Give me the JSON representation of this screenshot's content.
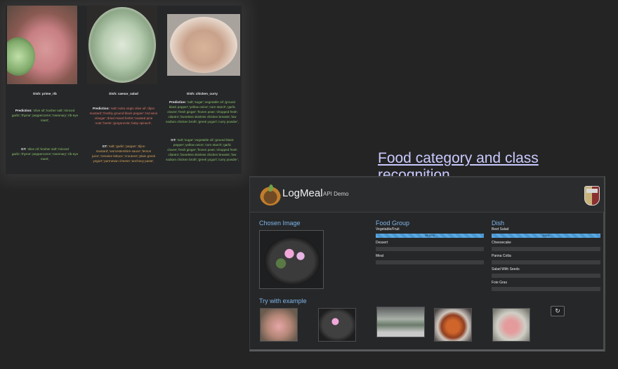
{
  "recipe_panel": {
    "columns": [
      {
        "dish": "Dish: prime_rib",
        "pred_label": "Prediction:",
        "pred_items": [
          {
            "t": "'olive oil','kosher salt','minced garlic','thyme','peppercorns','rosemary','rib-eye roast',",
            "s": "ok"
          }
        ],
        "gt_label": "GT:",
        "gt_items": [
          {
            "t": "'olive oil','kosher salt','minced garlic','thyme','peppercorns','rosemary','rib-eye roast',",
            "s": "ok"
          }
        ]
      },
      {
        "dish": "Dish: caesar_salad",
        "pred_label": "Prediction:",
        "pred_items": [
          {
            "t": "'salt','extra virgin olive oil','dijon mustard','freshly ground black pepper','red wine vinegar','dried mixed herbs','toasted pine nuts','beets','gorgonzola','baby spinach',",
            "s": "bad"
          }
        ],
        "gt_label": "GT:",
        "gt_items": [
          {
            "t": "'salt','garlic','pepper','dijon mustard','worcestershire sauce','lemon juice','romaine lettuce','croutons','plain greek yogurt','parmesan cheese','anchovy paste',",
            "s": "warn"
          }
        ]
      },
      {
        "dish": "Dish: chicken_curry",
        "pred_label": "Prediction:",
        "pred_items": [
          {
            "t": "'salt','sugar','vegetable oil','ground black pepper','yellow onion','corn starch','garlic cloves','fresh ginger','frozen peas','chopped fresh cilantro','boneless skinless chicken breasts','low sodium chicken broth','greek yogurt','curry powder',",
            "s": "ok"
          }
        ],
        "gt_label": "GT:",
        "gt_items": [
          {
            "t": "'salt','sugar','vegetable oil','ground black pepper','yellow onion','corn starch','garlic cloves','fresh ginger','frozen peas','chopped fresh cilantro','boneless skinless chicken breasts','low sodium chicken broth','greek yogurt','curry powder',",
            "s": "ok"
          }
        ]
      }
    ]
  },
  "caption": "Food category and class recognition",
  "logmeal": {
    "brand": "LogMeal",
    "subtitle": "API Demo",
    "chosen_image_title": "Chosen Image",
    "food_group": {
      "title": "Food Group",
      "rows": [
        {
          "label": "Vegetable/Fruit",
          "value": 0.9997,
          "text": "99.97%"
        },
        {
          "label": "Dessert",
          "value": 0,
          "text": ""
        },
        {
          "label": "Meat",
          "value": 0,
          "text": ""
        }
      ]
    },
    "dish": {
      "title": "Dish",
      "rows": [
        {
          "label": "Beet Salad",
          "value": 1.0,
          "text": "100%"
        },
        {
          "label": "Cheesecake",
          "value": 0,
          "text": ""
        },
        {
          "label": "Panna Cotta",
          "value": 0,
          "text": ""
        },
        {
          "label": "Salad With Seeds",
          "value": 0,
          "text": ""
        },
        {
          "label": "Foie Gras",
          "value": 0,
          "text": ""
        }
      ]
    },
    "try_title": "Try with example",
    "refresh_icon": "↻"
  }
}
